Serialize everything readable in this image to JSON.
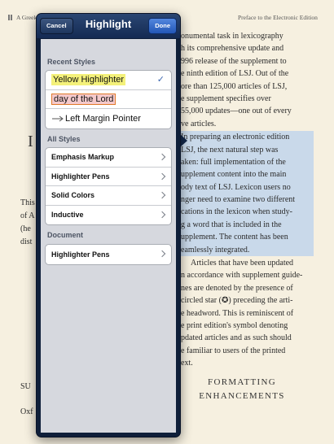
{
  "book": {
    "header_left": "A Greek",
    "header_right": "Preface to the Electronic Edition",
    "left_fragments": [
      "This",
      "of A",
      "(he",
      "dist",
      "SU",
      "Oxf"
    ],
    "left_big": "I",
    "lines_plain": [
      "onumental task in lexicography",
      "h its comprehensive update and",
      "996 release of the supplement to",
      "e ninth edition of LSJ. Out of the",
      "ore than 125,000 articles of LSJ,",
      "e supplement specifies over",
      "55,000 updates—one out of every",
      "ve articles."
    ],
    "lines_highlighted": [
      "In preparing an electronic edition",
      "LSJ, the next natural step was",
      "aken: full implementation of the",
      "upplement content into the main",
      "ody text of LSJ. Lexicon users no",
      "nger need to examine two different",
      "cations in the lexicon when study-",
      "g a word that is included in the",
      "upplement. The content has been",
      "eamlessly integrated."
    ],
    "lines_after": [
      "Articles that have been updated",
      "n accordance with supplement guide-",
      "nes are denoted by the presence of",
      "circled star (✪) preceding the arti-",
      "e headword. This is reminiscent of",
      "e print edition's symbol denoting",
      "pdated articles and as such should",
      "e familiar to users of the printed",
      "ext."
    ],
    "section_heading_1": "FORMATTING",
    "section_heading_2": "ENHANCEMENTS"
  },
  "popover": {
    "title": "Highlight",
    "cancel_label": "Cancel",
    "done_label": "Done",
    "recent_label": "Recent Styles",
    "recent_styles": [
      "Yellow Highlighter",
      "day of the Lord",
      "Left Margin Pointer"
    ],
    "all_label": "All Styles",
    "all_styles": [
      "Emphasis Markup",
      "Highlighter Pens",
      "Solid Colors",
      "Inductive"
    ],
    "document_label": "Document",
    "document_styles": [
      "Highlighter Pens"
    ]
  },
  "colors": {
    "navbar": "#1d355d",
    "done_button": "#2256b6",
    "selection_highlight": "#c9d9ea",
    "yellow_highlight": "#f4f17a",
    "pink_highlight": "#f4c9cb",
    "checkmark": "#3b66b0"
  },
  "icons": {
    "selected": "checkmark-icon",
    "disclosure": "chevron-right-icon",
    "margin_pointer": "arrow-pointer-icon"
  }
}
